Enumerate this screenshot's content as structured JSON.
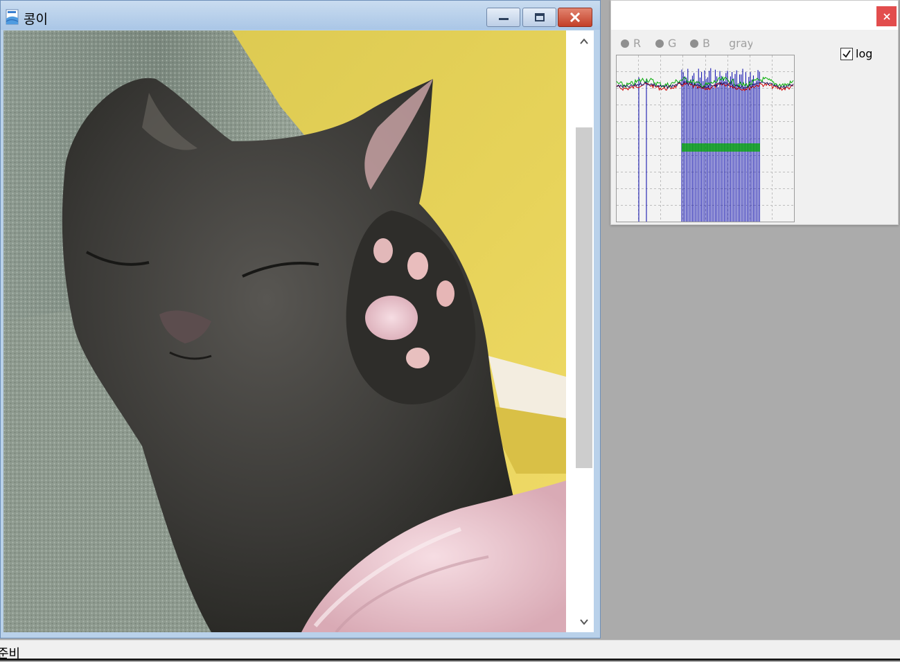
{
  "image_window": {
    "title": "콩이",
    "controls": {
      "minimize_icon": "minimize-icon",
      "maximize_icon": "maximize-icon",
      "close_icon": "close-icon"
    },
    "colors": {
      "titlebar": "#b9d1ea",
      "close_button": "#c33f28"
    }
  },
  "histogram_window": {
    "channels": [
      {
        "label": "R"
      },
      {
        "label": "G"
      },
      {
        "label": "B"
      },
      {
        "label": "gray"
      }
    ],
    "log_checkbox": {
      "label": "log",
      "checked": true
    },
    "close_icon": "close-icon",
    "colors": {
      "close_button": "#e24d4d",
      "red": "#cc0000",
      "green": "#00aa00",
      "blue": "#0000aa"
    }
  },
  "status_bar": {
    "text": "준비"
  }
}
